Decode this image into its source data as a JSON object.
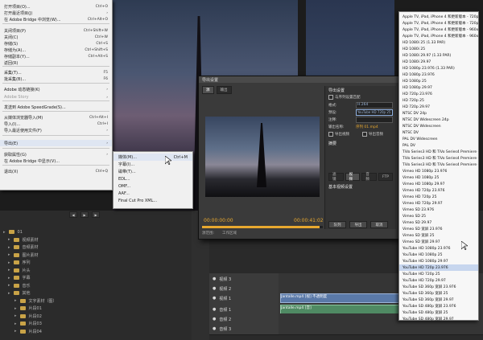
{
  "file_menu": {
    "items": [
      {
        "label": "打开项目(O)...",
        "shortcut": "Ctrl+O"
      },
      {
        "label": "打开最近项目(J)",
        "shortcut": ""
      },
      {
        "label": "在 Adobe Bridge 中浏览(W)...",
        "shortcut": "Ctrl+Alt+O"
      },
      {
        "label": "关闭项目(P)",
        "shortcut": "Ctrl+Shift+W"
      },
      {
        "label": "关闭(C)",
        "shortcut": "Ctrl+W"
      },
      {
        "label": "存储(S)",
        "shortcut": "Ctrl+S"
      },
      {
        "label": "存储为(A)...",
        "shortcut": "Ctrl+Shift+S"
      },
      {
        "label": "存储副本(Y)...",
        "shortcut": "Ctrl+Alt+S"
      },
      {
        "label": "返回(R)",
        "shortcut": ""
      },
      {
        "label": "采集(T)...",
        "shortcut": "F5"
      },
      {
        "label": "批采集(B)...",
        "shortcut": "F6"
      },
      {
        "label": "Adobe 动态链接(K)",
        "shortcut": ""
      },
      {
        "label": "Adobe Story",
        "shortcut": ""
      },
      {
        "label": "发送到 Adobe SpeedGrade(S)...",
        "shortcut": ""
      },
      {
        "label": "从媒体浏览器导入(M)",
        "shortcut": "Ctrl+Alt+I"
      },
      {
        "label": "导入(I)...",
        "shortcut": "Ctrl+I"
      },
      {
        "label": "导入最近使用文件(F)",
        "shortcut": ""
      },
      {
        "label": "导出(E)",
        "shortcut": ""
      },
      {
        "label": "获取属性(G)",
        "shortcut": ""
      },
      {
        "label": "在 Adobe Bridge 中显示(V)...",
        "shortcut": ""
      },
      {
        "label": "退出(X)",
        "shortcut": "Ctrl+Q"
      }
    ]
  },
  "export_submenu": {
    "items": [
      {
        "label": "媒体(M)...",
        "shortcut": "Ctrl+M"
      },
      {
        "label": "字幕(I)...",
        "shortcut": ""
      },
      {
        "label": "磁带(T)...",
        "shortcut": ""
      },
      {
        "label": "EDL...",
        "shortcut": ""
      },
      {
        "label": "OMF...",
        "shortcut": ""
      },
      {
        "label": "AAF...",
        "shortcut": ""
      },
      {
        "label": "Final Cut Pro XML...",
        "shortcut": ""
      }
    ]
  },
  "export_dialog": {
    "title": "导出设置",
    "tabs": [
      "源",
      "输出"
    ],
    "timecode_in": "00:00:00:00",
    "timecode_out": "00:00:41:02",
    "bottom_labels": [
      "源范围:",
      "工作区域"
    ],
    "right": {
      "section_export": "导出设置",
      "match_label": "与序列设置匹配",
      "format_label": "格式:",
      "format_value": "H.264",
      "preset_label": "预设:",
      "preset_value": "YouTube HD 720p 25",
      "comment_label": "注释:",
      "output_label": "输出名称:",
      "output_value": "序列 01.mp4",
      "export_video": "导出视频",
      "export_audio": "导出音频",
      "summary": "摘要",
      "tabs": [
        "滤镜",
        "视频",
        "音频",
        "FTP"
      ],
      "basic_video": "基本视频设置",
      "queue_btn": "队列",
      "export_btn": "导出",
      "cancel_btn": "取消"
    },
    "scrub_position": 0.97
  },
  "preset_list": {
    "items": [
      "Apple TV, iPad, iPhone 4 和更新版本 - 720p 25",
      "Apple TV, iPad, iPhone 4 和更新版本 - 720p 29.97",
      "Apple TV, iPad, iPhone 4 和更新版本 - 960x540 25",
      "Apple TV, iPad, iPhone 4 和更新版本 - 960x540 29.97",
      "HD 1080i 25 (1.33 PAR)",
      "HD 1080i 25",
      "HD 1080i 29.97 (1.33 PAR)",
      "HD 1080i 29.97",
      "HD 1080p 23.976 (1.33 PAR)",
      "HD 1080p 23.976",
      "HD 1080p 25",
      "HD 1080p 29.97",
      "HD 720p 23.976",
      "HD 720p 25",
      "HD 720p 29.97",
      "NTSC DV 24p",
      "NTSC DV Widescreen 24p",
      "NTSC DV Widescreen",
      "NTSC DV",
      "PAL DV Widescreen",
      "PAL DV",
      "TiVo Series3 HD 和 TiVo Series4 Premiere - HD 720p 25",
      "TiVo Series3 HD 和 TiVo Series4 Premiere - SD 360p 25",
      "TiVo Series3 HD 和 TiVo Series4 Premiere - SD 360p 29.97",
      "Vimeo HD 1080p 23.976",
      "Vimeo HD 1080p 25",
      "Vimeo HD 1080p 29.97",
      "Vimeo HD 720p 23.976",
      "Vimeo HD 720p 25",
      "Vimeo HD 720p 29.97",
      "Vimeo SD 23.976",
      "Vimeo SD 25",
      "Vimeo SD 29.97",
      "Vimeo SD 宽屏 23.976",
      "Vimeo SD 宽屏 25",
      "Vimeo SD 宽屏 29.97",
      "YouTube HD 1080p 23.976",
      "YouTube HD 1080p 25",
      "YouTube HD 1080p 29.97",
      "YouTube HD 720p 23.976",
      "YouTube HD 720p 25",
      "YouTube HD 720p 29.97",
      "YouTube SD 360p 宽屏 23.976",
      "YouTube SD 360p 宽屏 25",
      "YouTube SD 360p 宽屏 29.97",
      "YouTube SD 480p 宽屏 23.976",
      "YouTube SD 480p 宽屏 25",
      "YouTube SD 480p 宽屏 29.97"
    ],
    "highlighted_index": 39
  },
  "project_panel": {
    "rows": [
      "01",
      "视频素材",
      "音频素材",
      "图片素材",
      "序列",
      "片头",
      "字幕",
      "音乐",
      "其他",
      "文字素材（图）",
      "片段01",
      "片段02",
      "片段03",
      "片段04"
    ]
  },
  "timeline": {
    "tracks": [
      {
        "name": "视频 3"
      },
      {
        "name": "视频 2"
      },
      {
        "name": "视频 1",
        "clip": "Jantalle.mp4 [视] 不透明度"
      },
      {
        "name": "音频 1",
        "clip": "Jantalle.mp4 [音]"
      },
      {
        "name": "音频 2"
      },
      {
        "name": "音频 3"
      }
    ]
  }
}
